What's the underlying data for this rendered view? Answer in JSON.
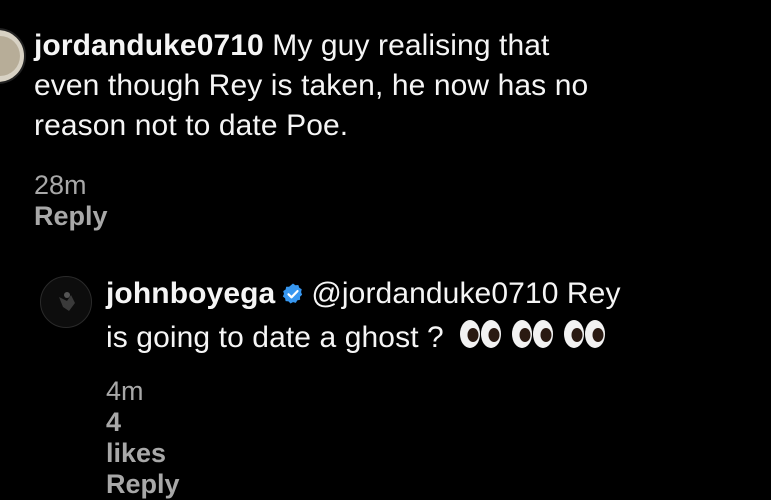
{
  "comment": {
    "username": "jordanduke0710",
    "text_line1": "My guy realising that",
    "text_line2": "even though Rey is taken, he now has no",
    "text_line3": "reason not to date Poe.",
    "time": "28m",
    "reply_label": "Reply"
  },
  "reply": {
    "username": "johnboyega",
    "mention": "@jordanduke0710",
    "text_line1_suffix": "Rey",
    "text_line2": "is going to date a ghost ?",
    "emoji": "eyes",
    "emoji_count": 3,
    "time": "4m",
    "likes": "4 likes",
    "reply_label": "Reply",
    "verified_color": "#3797f0"
  }
}
